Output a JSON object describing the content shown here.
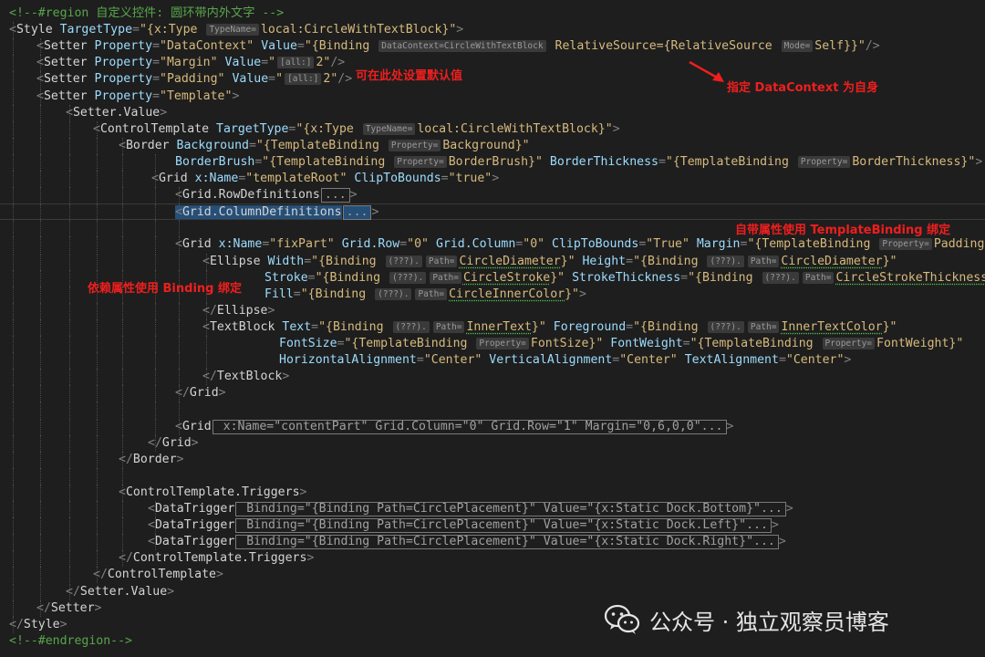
{
  "lines": [
    [
      [
        "c",
        "<!--#region 自定义控件: 圆环带内外文字 -->"
      ]
    ],
    [
      [
        "p",
        "<"
      ],
      [
        "t",
        "Style"
      ],
      [
        "s",
        " "
      ],
      [
        "a",
        "TargetType"
      ],
      [
        "p",
        "="
      ],
      [
        "v",
        "\"{x:Type "
      ],
      [
        "h",
        "TypeName="
      ],
      [
        "v",
        "local:CircleWithTextBlock}\""
      ],
      [
        "p",
        ">"
      ]
    ],
    [
      [
        "p",
        "<"
      ],
      [
        "t",
        "Setter"
      ],
      [
        "s",
        " "
      ],
      [
        "a",
        "Property"
      ],
      [
        "p",
        "="
      ],
      [
        "v",
        "\"DataContext\""
      ],
      [
        "s",
        " "
      ],
      [
        "a",
        "Value"
      ],
      [
        "p",
        "="
      ],
      [
        "v",
        "\"{Binding "
      ],
      [
        "h",
        "DataContext=CircleWithTextBlock"
      ],
      [
        "v",
        " RelativeSource={RelativeSource "
      ],
      [
        "h",
        "Mode="
      ],
      [
        "v",
        "Self}}\""
      ],
      [
        "p",
        "/>"
      ]
    ],
    [
      [
        "p",
        "<"
      ],
      [
        "t",
        "Setter"
      ],
      [
        "s",
        " "
      ],
      [
        "a",
        "Property"
      ],
      [
        "p",
        "="
      ],
      [
        "v",
        "\"Margin\""
      ],
      [
        "s",
        " "
      ],
      [
        "a",
        "Value"
      ],
      [
        "p",
        "="
      ],
      [
        "v",
        "\""
      ],
      [
        "h",
        "[all:]"
      ],
      [
        "v",
        "2\""
      ],
      [
        "p",
        "/>"
      ]
    ],
    [
      [
        "p",
        "<"
      ],
      [
        "t",
        "Setter"
      ],
      [
        "s",
        " "
      ],
      [
        "a",
        "Property"
      ],
      [
        "p",
        "="
      ],
      [
        "v",
        "\"Padding\""
      ],
      [
        "s",
        " "
      ],
      [
        "a",
        "Value"
      ],
      [
        "p",
        "="
      ],
      [
        "v",
        "\""
      ],
      [
        "h",
        "[all:]"
      ],
      [
        "v",
        "2\""
      ],
      [
        "p",
        "/>"
      ]
    ],
    [
      [
        "p",
        "<"
      ],
      [
        "t",
        "Setter"
      ],
      [
        "s",
        " "
      ],
      [
        "a",
        "Property"
      ],
      [
        "p",
        "="
      ],
      [
        "v",
        "\"Template\""
      ],
      [
        "p",
        ">"
      ]
    ],
    [
      [
        "p",
        "<"
      ],
      [
        "t",
        "Setter.Value"
      ],
      [
        "p",
        ">"
      ]
    ],
    [
      [
        "p",
        "<"
      ],
      [
        "t",
        "ControlTemplate"
      ],
      [
        "s",
        " "
      ],
      [
        "a",
        "TargetType"
      ],
      [
        "p",
        "="
      ],
      [
        "v",
        "\"{x:Type "
      ],
      [
        "h",
        "TypeName="
      ],
      [
        "v",
        "local:CircleWithTextBlock}\""
      ],
      [
        "p",
        ">"
      ]
    ],
    [
      [
        "p",
        "<"
      ],
      [
        "t",
        "Border"
      ],
      [
        "s",
        " "
      ],
      [
        "a",
        "Background"
      ],
      [
        "p",
        "="
      ],
      [
        "v",
        "\"{TemplateBinding "
      ],
      [
        "h",
        "Property="
      ],
      [
        "v",
        "Background}\""
      ]
    ],
    [
      [
        "a",
        "BorderBrush"
      ],
      [
        "p",
        "="
      ],
      [
        "v",
        "\"{TemplateBinding "
      ],
      [
        "h",
        "Property="
      ],
      [
        "v",
        "BorderBrush}\""
      ],
      [
        "s",
        " "
      ],
      [
        "a",
        "BorderThickness"
      ],
      [
        "p",
        "="
      ],
      [
        "v",
        "\"{TemplateBinding "
      ],
      [
        "h",
        "Property="
      ],
      [
        "v",
        "BorderThickness}\""
      ],
      [
        "p",
        ">"
      ]
    ],
    [
      [
        "p",
        "<"
      ],
      [
        "t",
        "Grid"
      ],
      [
        "s",
        " "
      ],
      [
        "a",
        "x:Name"
      ],
      [
        "p",
        "="
      ],
      [
        "v",
        "\"templateRoot\""
      ],
      [
        "s",
        " "
      ],
      [
        "a",
        "ClipToBounds"
      ],
      [
        "p",
        "="
      ],
      [
        "v",
        "\"true\""
      ],
      [
        "p",
        ">"
      ]
    ],
    [
      [
        "p",
        "<"
      ],
      [
        "t",
        "Grid.RowDefinitions"
      ],
      [
        "f",
        "..."
      ],
      [
        "p",
        ">"
      ]
    ],
    [
      [
        "p",
        "<"
      ],
      [
        "t",
        "Grid.ColumnDefinitions"
      ],
      [
        "f",
        "..."
      ],
      [
        "p",
        ">"
      ]
    ],
    [],
    [
      [
        "p",
        "<"
      ],
      [
        "t",
        "Grid"
      ],
      [
        "s",
        " "
      ],
      [
        "a",
        "x:Name"
      ],
      [
        "p",
        "="
      ],
      [
        "v",
        "\"fixPart\""
      ],
      [
        "s",
        " "
      ],
      [
        "a",
        "Grid.Row"
      ],
      [
        "p",
        "="
      ],
      [
        "v",
        "\"0\""
      ],
      [
        "s",
        " "
      ],
      [
        "a",
        "Grid.Column"
      ],
      [
        "p",
        "="
      ],
      [
        "v",
        "\"0\""
      ],
      [
        "s",
        " "
      ],
      [
        "a",
        "ClipToBounds"
      ],
      [
        "p",
        "="
      ],
      [
        "v",
        "\"True\""
      ],
      [
        "s",
        " "
      ],
      [
        "a",
        "Margin"
      ],
      [
        "p",
        "="
      ],
      [
        "v",
        "\"{TemplateBinding "
      ],
      [
        "h",
        "Property="
      ],
      [
        "v",
        "Padding}\""
      ],
      [
        "p",
        ">"
      ]
    ],
    [
      [
        "p",
        "<"
      ],
      [
        "t",
        "Ellipse"
      ],
      [
        "s",
        " "
      ],
      [
        "a",
        "Width"
      ],
      [
        "p",
        "="
      ],
      [
        "v",
        "\"{Binding "
      ],
      [
        "h",
        "(???)."
      ],
      [
        "h",
        "Path="
      ],
      [
        "q",
        "CircleDiameter"
      ],
      [
        "v",
        "}\""
      ],
      [
        "s",
        " "
      ],
      [
        "a",
        "Height"
      ],
      [
        "p",
        "="
      ],
      [
        "v",
        "\"{Binding "
      ],
      [
        "h",
        "(???)."
      ],
      [
        "h",
        "Path="
      ],
      [
        "q",
        "CircleDiameter"
      ],
      [
        "v",
        "}\""
      ]
    ],
    [
      [
        "a",
        "Stroke"
      ],
      [
        "p",
        "="
      ],
      [
        "v",
        "\"{Binding "
      ],
      [
        "h",
        "(???)."
      ],
      [
        "h",
        "Path="
      ],
      [
        "q",
        "CircleStroke"
      ],
      [
        "v",
        "}\""
      ],
      [
        "s",
        " "
      ],
      [
        "a",
        "StrokeThickness"
      ],
      [
        "p",
        "="
      ],
      [
        "v",
        "\"{Binding "
      ],
      [
        "h",
        "(???)."
      ],
      [
        "h",
        "Path="
      ],
      [
        "q",
        "CircleStrokeThickness"
      ],
      [
        "v",
        "}\""
      ]
    ],
    [
      [
        "a",
        "Fill"
      ],
      [
        "p",
        "="
      ],
      [
        "v",
        "\"{Binding "
      ],
      [
        "h",
        "(???)."
      ],
      [
        "h",
        "Path="
      ],
      [
        "q",
        "CircleInnerColor"
      ],
      [
        "v",
        "}\""
      ],
      [
        "p",
        ">"
      ]
    ],
    [
      [
        "p",
        "</"
      ],
      [
        "t",
        "Ellipse"
      ],
      [
        "p",
        ">"
      ]
    ],
    [
      [
        "p",
        "<"
      ],
      [
        "t",
        "TextBlock"
      ],
      [
        "s",
        " "
      ],
      [
        "a",
        "Text"
      ],
      [
        "p",
        "="
      ],
      [
        "v",
        "\"{Binding "
      ],
      [
        "h",
        "(???)."
      ],
      [
        "h",
        "Path="
      ],
      [
        "q",
        "InnerText"
      ],
      [
        "v",
        "}\""
      ],
      [
        "s",
        " "
      ],
      [
        "a",
        "Foreground"
      ],
      [
        "p",
        "="
      ],
      [
        "v",
        "\"{Binding "
      ],
      [
        "h",
        "(???)."
      ],
      [
        "h",
        "Path="
      ],
      [
        "q",
        "InnerTextColor"
      ],
      [
        "v",
        "}\""
      ]
    ],
    [
      [
        "a",
        "FontSize"
      ],
      [
        "p",
        "="
      ],
      [
        "v",
        "\"{TemplateBinding "
      ],
      [
        "h",
        "Property="
      ],
      [
        "v",
        "FontSize}\""
      ],
      [
        "s",
        " "
      ],
      [
        "a",
        "FontWeight"
      ],
      [
        "p",
        "="
      ],
      [
        "v",
        "\"{TemplateBinding "
      ],
      [
        "h",
        "Property="
      ],
      [
        "v",
        "FontWeight}\""
      ]
    ],
    [
      [
        "a",
        "HorizontalAlignment"
      ],
      [
        "p",
        "="
      ],
      [
        "v",
        "\"Center\""
      ],
      [
        "s",
        " "
      ],
      [
        "a",
        "VerticalAlignment"
      ],
      [
        "p",
        "="
      ],
      [
        "v",
        "\"Center\""
      ],
      [
        "s",
        " "
      ],
      [
        "a",
        "TextAlignment"
      ],
      [
        "p",
        "="
      ],
      [
        "v",
        "\"Center\""
      ],
      [
        "p",
        ">"
      ]
    ],
    [
      [
        "p",
        "</"
      ],
      [
        "t",
        "TextBlock"
      ],
      [
        "p",
        ">"
      ]
    ],
    [
      [
        "p",
        "</"
      ],
      [
        "t",
        "Grid"
      ],
      [
        "p",
        ">"
      ]
    ],
    [],
    [
      [
        "p",
        "<"
      ],
      [
        "t",
        "Grid"
      ],
      [
        "f",
        " x:Name=\"contentPart\" Grid.Column=\"0\" Grid.Row=\"1\" Margin=\"0,6,0,0\"..."
      ],
      [
        "p",
        ">"
      ]
    ],
    [
      [
        "p",
        "</"
      ],
      [
        "t",
        "Grid"
      ],
      [
        "p",
        ">"
      ]
    ],
    [
      [
        "p",
        "</"
      ],
      [
        "t",
        "Border"
      ],
      [
        "p",
        ">"
      ]
    ],
    [],
    [
      [
        "p",
        "<"
      ],
      [
        "t",
        "ControlTemplate.Triggers"
      ],
      [
        "p",
        ">"
      ]
    ],
    [
      [
        "p",
        "<"
      ],
      [
        "t",
        "DataTrigger"
      ],
      [
        "f",
        " Binding=\"{Binding Path=CirclePlacement}\" Value=\"{x:Static Dock.Bottom}\"..."
      ],
      [
        "p",
        ">"
      ]
    ],
    [
      [
        "p",
        "<"
      ],
      [
        "t",
        "DataTrigger"
      ],
      [
        "f",
        " Binding=\"{Binding Path=CirclePlacement}\" Value=\"{x:Static Dock.Left}\"..."
      ],
      [
        "p",
        ">"
      ]
    ],
    [
      [
        "p",
        "<"
      ],
      [
        "t",
        "DataTrigger"
      ],
      [
        "f",
        " Binding=\"{Binding Path=CirclePlacement}\" Value=\"{x:Static Dock.Right}\"..."
      ],
      [
        "p",
        ">"
      ]
    ],
    [
      [
        "p",
        "</"
      ],
      [
        "t",
        "ControlTemplate.Triggers"
      ],
      [
        "p",
        ">"
      ]
    ],
    [
      [
        "p",
        "</"
      ],
      [
        "t",
        "ControlTemplate"
      ],
      [
        "p",
        ">"
      ]
    ],
    [
      [
        "p",
        "</"
      ],
      [
        "t",
        "Setter.Value"
      ],
      [
        "p",
        ">"
      ]
    ],
    [
      [
        "p",
        "</"
      ],
      [
        "t",
        "Setter"
      ],
      [
        "p",
        ">"
      ]
    ],
    [
      [
        "p",
        "</"
      ],
      [
        "t",
        "Style"
      ],
      [
        "p",
        ">"
      ]
    ],
    [
      [
        "c",
        "<!--#endregion-->"
      ]
    ]
  ],
  "annotations": {
    "default_value": "可在此处设置默认值",
    "datacontext_self": "指定 DataContext 为自身",
    "templatebinding": "自带属性使用 TemplateBinding 绑定",
    "binding": "依赖属性使用 Binding 绑定"
  },
  "watermark": {
    "text": "公众号 · 独立观察员博客",
    "icon": "wechat-icon"
  }
}
